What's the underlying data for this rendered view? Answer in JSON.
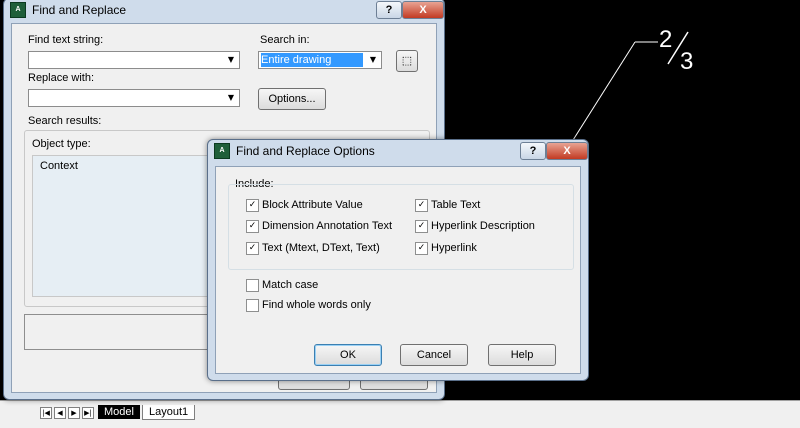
{
  "main_dialog": {
    "title": "Find and Replace",
    "find_label": "Find text string:",
    "find_value": "",
    "search_in_label": "Search in:",
    "search_in_value": "Entire drawing",
    "replace_label": "Replace with:",
    "replace_value": "",
    "options_button": "Options...",
    "search_results_label": "Search results:",
    "object_type_label": "Object type:",
    "context_label": "Context",
    "help_caption": "?",
    "close_caption": "X"
  },
  "options_dialog": {
    "title": "Find and Replace Options",
    "include_label": "Include:",
    "checkboxes_left": [
      {
        "label": "Block Attribute Value",
        "checked": true
      },
      {
        "label": "Dimension Annotation Text",
        "checked": true
      },
      {
        "label": "Text (Mtext, DText, Text)",
        "checked": true
      }
    ],
    "checkboxes_right": [
      {
        "label": "Table Text",
        "checked": true
      },
      {
        "label": "Hyperlink Description",
        "checked": true
      },
      {
        "label": "Hyperlink",
        "checked": true
      }
    ],
    "match_case": {
      "label": "Match case",
      "checked": false
    },
    "whole_words": {
      "label": "Find whole words only",
      "checked": false
    },
    "ok_button": "OK",
    "cancel_button": "Cancel",
    "help_button": "Help",
    "help_caption": "?",
    "close_caption": "X"
  },
  "drawing": {
    "numerator": "2",
    "denominator": "3"
  },
  "tabs": {
    "model": "Model",
    "layout1": "Layout1"
  },
  "colors": {
    "selection": "#3399ff",
    "drawing_bg": "#000000"
  }
}
